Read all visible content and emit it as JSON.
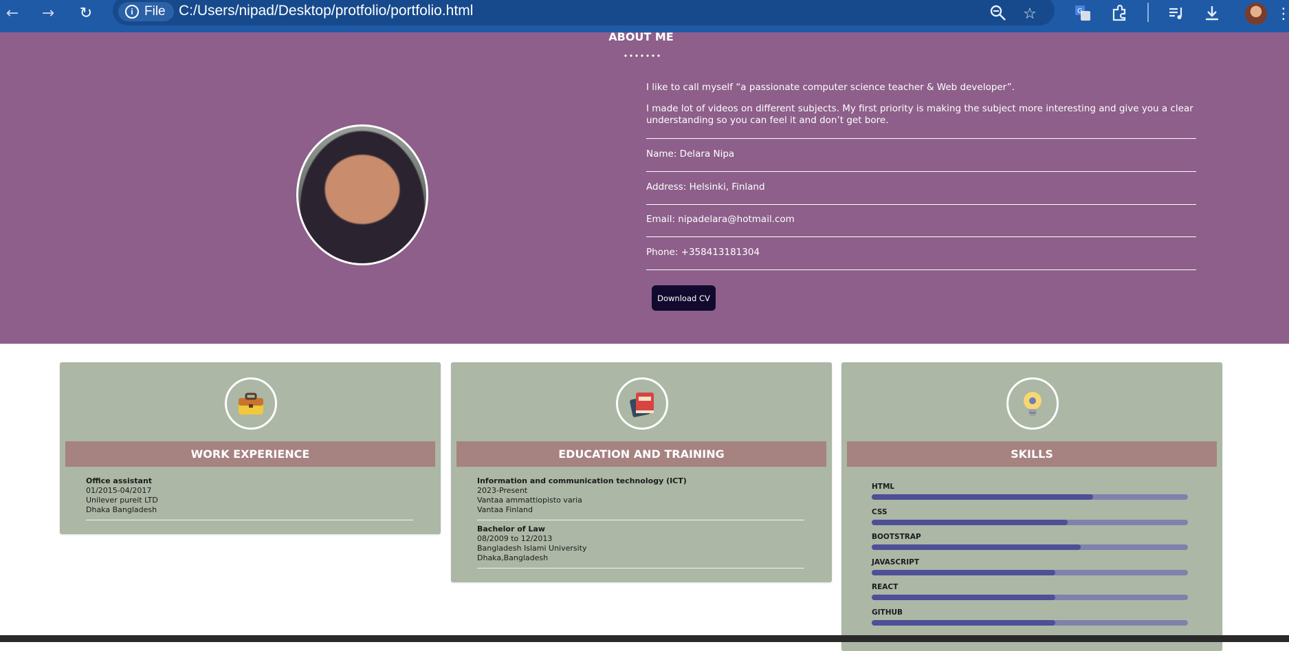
{
  "browser": {
    "back": "←",
    "forward": "→",
    "reload": "↻",
    "file_label": "File",
    "url": "C:/Users/nipad/Desktop/protfolio/portfolio.html"
  },
  "about": {
    "title": "ABOUT ME",
    "intro": "I like to call myself “a passionate computer science teacher & Web developer”.",
    "bio": "I made lot of videos on different subjects. My first priority is making the subject more interesting and give you a clear understanding so you can feel it and don’t get bore.",
    "name": "Name: Delara Nipa",
    "address": "Address: Helsinki, Finland",
    "email": "Email: nipadelara@hotmail.com",
    "phone": "Phone: +358413181304",
    "download_label": "Download CV"
  },
  "work": {
    "heading": "WORK EXPERIENCE",
    "entries": [
      {
        "title": "Office assistant",
        "period": "01/2015-04/2017",
        "org": "Unilever pureit LTD",
        "place": "Dhaka Bangladesh"
      }
    ]
  },
  "education": {
    "heading": "EDUCATION AND TRAINING",
    "entries": [
      {
        "title": "Information and communication technology (ICT)",
        "period": "2023-Present",
        "org": "Vantaa ammattiopisto varia",
        "place": "Vantaa Finland"
      },
      {
        "title": "Bachelor of Law",
        "period": "08/2009 to 12/2013",
        "org": "Bangladesh Islami University",
        "place": "Dhaka,Bangladesh"
      }
    ]
  },
  "skills": {
    "heading": "SKILLS",
    "items": [
      {
        "label": "HTML",
        "level": 0.7
      },
      {
        "label": "CSS",
        "level": 0.62
      },
      {
        "label": "BOOTSTRAP",
        "level": 0.66
      },
      {
        "label": "JAVASCRIPT",
        "level": 0.58
      },
      {
        "label": "REACT",
        "level": 0.58
      },
      {
        "label": "GITHUB",
        "level": 0.58
      }
    ]
  },
  "icons": {
    "work": "briefcase-icon",
    "education": "book-icon",
    "skills": "lightbulb-icon"
  }
}
